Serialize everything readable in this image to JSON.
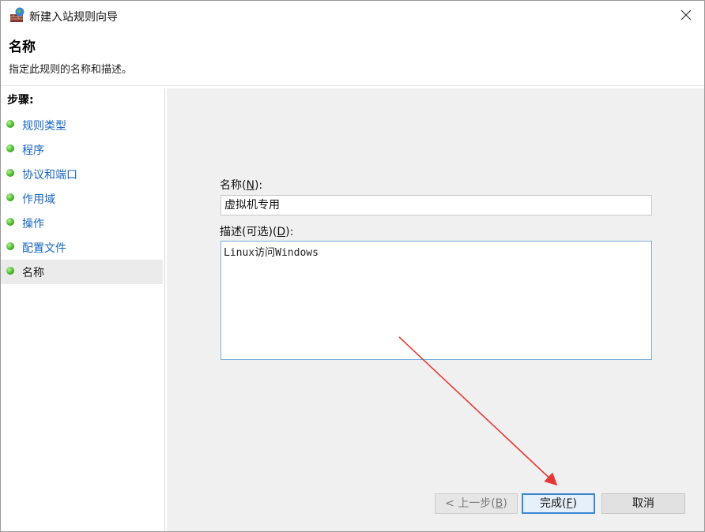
{
  "window": {
    "title": "新建入站规则向导",
    "icon": "firewall-icon"
  },
  "header": {
    "title": "名称",
    "description": "指定此规则的名称和描述。"
  },
  "sidebar": {
    "heading": "步骤:",
    "items": [
      {
        "label": "规则类型",
        "active": false
      },
      {
        "label": "程序",
        "active": false
      },
      {
        "label": "协议和端口",
        "active": false
      },
      {
        "label": "作用域",
        "active": false
      },
      {
        "label": "操作",
        "active": false
      },
      {
        "label": "配置文件",
        "active": false
      },
      {
        "label": "名称",
        "active": true
      }
    ]
  },
  "form": {
    "name_label_text": "名称(",
    "name_label_key": "N",
    "name_label_end": "):",
    "name_value": "虚拟机专用",
    "desc_label_text": "描述(可选)(",
    "desc_label_key": "D",
    "desc_label_end": "):",
    "desc_value": "Linux访问Windows"
  },
  "buttons": {
    "back_text": "< 上一步(",
    "back_key": "B",
    "finish_text": "完成(",
    "finish_key": "F",
    "key_end": ")",
    "cancel": "取消"
  },
  "colors": {
    "link": "#1565c0",
    "annotation_arrow": "#e53935",
    "finish_border": "#3b86d6"
  }
}
